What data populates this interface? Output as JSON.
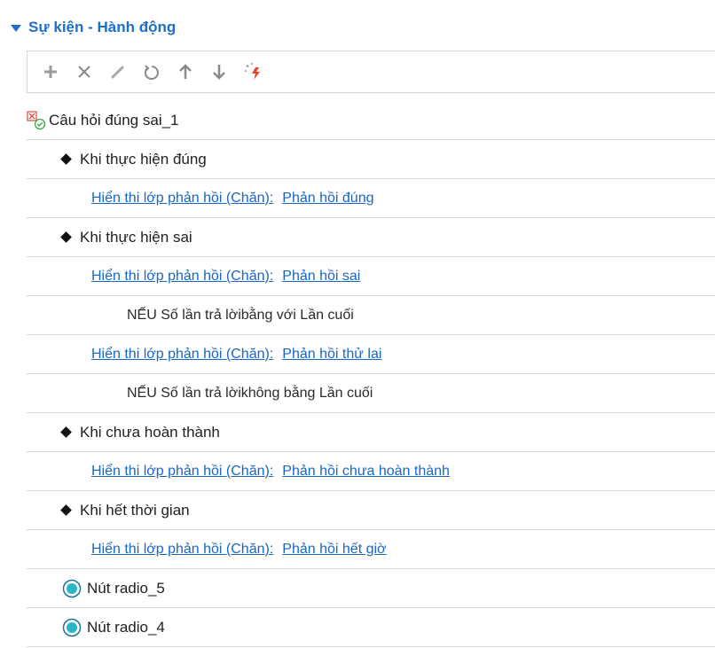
{
  "panel": {
    "title": "Sự kiện - Hành động",
    "accent_color": "#1e6fc9",
    "link_color": "#1a66c2"
  },
  "toolbar": {
    "buttons": [
      {
        "name": "add",
        "icon": "plus-icon"
      },
      {
        "name": "delete",
        "icon": "x-icon"
      },
      {
        "name": "edit",
        "icon": "pencil-icon"
      },
      {
        "name": "undo",
        "icon": "rotate-icon"
      },
      {
        "name": "move-up",
        "icon": "arrow-up-icon"
      },
      {
        "name": "move-down",
        "icon": "arrow-down-icon"
      },
      {
        "name": "magic",
        "icon": "sparkle-bolt-icon"
      }
    ]
  },
  "tree": {
    "root": {
      "label": "Câu hỏi đúng sai_1",
      "icon": "quiz-true-false-icon"
    },
    "e1": {
      "label": "Khi thực hiện đúng"
    },
    "a1": {
      "action": "Hiển thi lớp phản hồi (Chăn):",
      "target": "Phản hồi đúng"
    },
    "e2": {
      "label": "Khi thực hiện sai"
    },
    "a2": {
      "action": "Hiển thi lớp phản hồi (Chăn):",
      "target": "Phản hồi sai"
    },
    "c2": {
      "label": "NẾU Số lần trả lờibằng với Lần cuối"
    },
    "a3": {
      "action": "Hiển thi lớp phản hồi (Chăn):",
      "target": "Phản hồi thử lai"
    },
    "c3": {
      "label": "NẾU Số lần trả lờikhông bằng Lần cuối"
    },
    "e3": {
      "label": "Khi chưa hoàn thành"
    },
    "a4": {
      "action": "Hiển thi lớp phản hồi (Chăn):",
      "target": "Phản hồi chưa hoàn thành"
    },
    "e4": {
      "label": "Khi hết thời gian"
    },
    "a5": {
      "action": "Hiển thi lớp phản hồi (Chăn):",
      "target": "Phản hồi hết giờ"
    },
    "o1": {
      "label": "Nút radio_5",
      "icon": "radio-icon"
    },
    "o2": {
      "label": "Nút radio_4",
      "icon": "radio-icon"
    }
  }
}
